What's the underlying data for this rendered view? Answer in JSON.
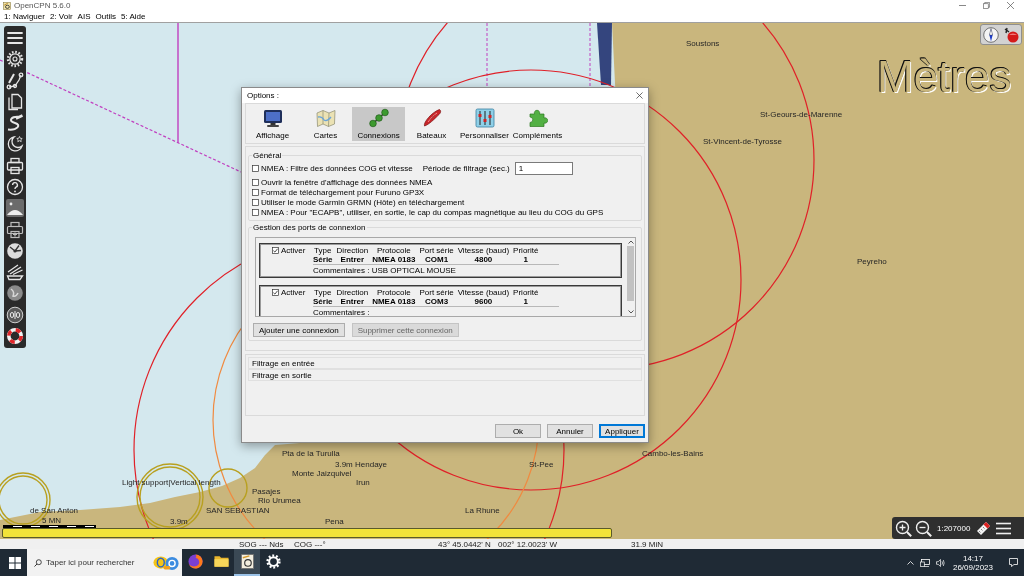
{
  "window": {
    "title": "OpenCPN 5.6.0"
  },
  "menu": [
    "1: Naviguer",
    "2: Voir",
    "AIS",
    "Outils",
    "5: Aide"
  ],
  "toolbar": [
    {
      "kind": "menu",
      "on": false
    },
    {
      "kind": "settings",
      "on": false
    },
    {
      "kind": "route",
      "on": false
    },
    {
      "kind": "documents",
      "on": false
    },
    {
      "kind": "track",
      "on": false
    },
    {
      "kind": "night",
      "on": false
    },
    {
      "kind": "print",
      "on": false
    },
    {
      "kind": "help",
      "on": false
    },
    {
      "kind": "dusk",
      "on": true
    },
    {
      "kind": "print-plus",
      "on": false
    },
    {
      "kind": "dashboard",
      "on": false
    },
    {
      "kind": "ais",
      "on": false
    },
    {
      "kind": "globe",
      "on": false
    },
    {
      "kind": "tide",
      "on": false
    },
    {
      "kind": "lifebuoy",
      "on": false
    }
  ],
  "chart": {
    "unit_label": "Mètres",
    "map_labels": [
      "Soustons",
      "St-Geours-de-Marenne",
      "St-Vincent-de-Tyrosse",
      "Peyreho",
      "Pta de la Turulla",
      "Cambo-les-Bains",
      "3.9m",
      "Hendaye",
      "St-Pee",
      "Monte Jaizquivel",
      "Light support|Vertical length",
      "Irun",
      "Pasajes",
      "Rio Urumea",
      "de San Anton",
      "SAN SEBASTIAN",
      "La Rhune",
      "3.9m",
      "Pena"
    ],
    "scale_bar": "5 MN",
    "zoom_scale": "1:207000"
  },
  "dialog": {
    "title": "Options :",
    "tabs": [
      {
        "kind": "display",
        "label": "Affichage",
        "selected": false
      },
      {
        "kind": "charts",
        "label": "Cartes",
        "selected": false
      },
      {
        "kind": "connections",
        "label": "Connexions",
        "selected": true
      },
      {
        "kind": "ships",
        "label": "Bateaux",
        "selected": false
      },
      {
        "kind": "settings",
        "label": "Personnaliser",
        "selected": false
      },
      {
        "kind": "plugins",
        "label": "Compléments",
        "selected": false
      }
    ],
    "general": {
      "title": "Général",
      "filter": {
        "label": "NMEA : Filtre des données COG et vitesse",
        "checked": false
      },
      "period": {
        "label": "Période de filtrage (sec.)",
        "value": "1"
      },
      "options": [
        {
          "label": "Ouvrir la fenêtre d'affichage des données NMEA",
          "checked": false
        },
        {
          "label": "Format de téléchargement pour Furuno GP3X",
          "checked": false
        },
        {
          "label": "Utiliser le mode Garmin GRMN (Hôte) en téléchargement",
          "checked": false
        },
        {
          "label": "NMEA : Pour \"ECAPB\", utiliser, en sortie, le cap du compas magnétique au lieu du COG du GPS",
          "checked": false
        }
      ]
    },
    "ports": {
      "title": "Gestion des ports de connexion",
      "connections": [
        {
          "enable_label": "Activer",
          "checked": true,
          "columns": [
            "Type",
            "Direction",
            "Protocole",
            "Port série",
            "Vitesse (baud)",
            "Priorité"
          ],
          "values": [
            "Série",
            "Entrer",
            "NMEA 0183",
            "COM1",
            "4800",
            "1"
          ],
          "comment": "Commentaires : USB OPTICAL MOUSE"
        },
        {
          "enable_label": "Activer",
          "checked": true,
          "columns": [
            "Type",
            "Direction",
            "Protocole",
            "Port série",
            "Vitesse (baud)",
            "Priorité"
          ],
          "values": [
            "Série",
            "Entrer",
            "NMEA 0183",
            "COM3",
            "9600",
            "1"
          ],
          "comment": "Commentaires :"
        }
      ],
      "buttons": [
        {
          "label": "Ajouter une connexion",
          "disabled": false
        },
        {
          "label": "Supprimer cette connexion",
          "disabled": true
        }
      ]
    },
    "filters": [
      "Filtrage en entrée",
      "Filtrage en sortie"
    ],
    "buttons": [
      {
        "label": "Ok",
        "default": false
      },
      {
        "label": "Annuler",
        "default": false
      },
      {
        "label": "Appliquer",
        "default": true
      }
    ]
  },
  "status_bar": [
    "SOG --- Nds",
    "COG ---°",
    "43° 45.0442' N",
    "002° 12.0023' W",
    "31.9 MiN"
  ],
  "taskbar": {
    "search": {
      "placeholder": "Taper ici pour rechercher"
    },
    "apps": [
      {
        "kind": "browser",
        "selected": false
      },
      {
        "kind": "folder",
        "selected": false
      },
      {
        "kind": "chart-app",
        "selected": true
      },
      {
        "kind": "settings",
        "selected": false
      }
    ],
    "clock": {
      "time": "14:17",
      "date": "26/09/2023"
    }
  }
}
